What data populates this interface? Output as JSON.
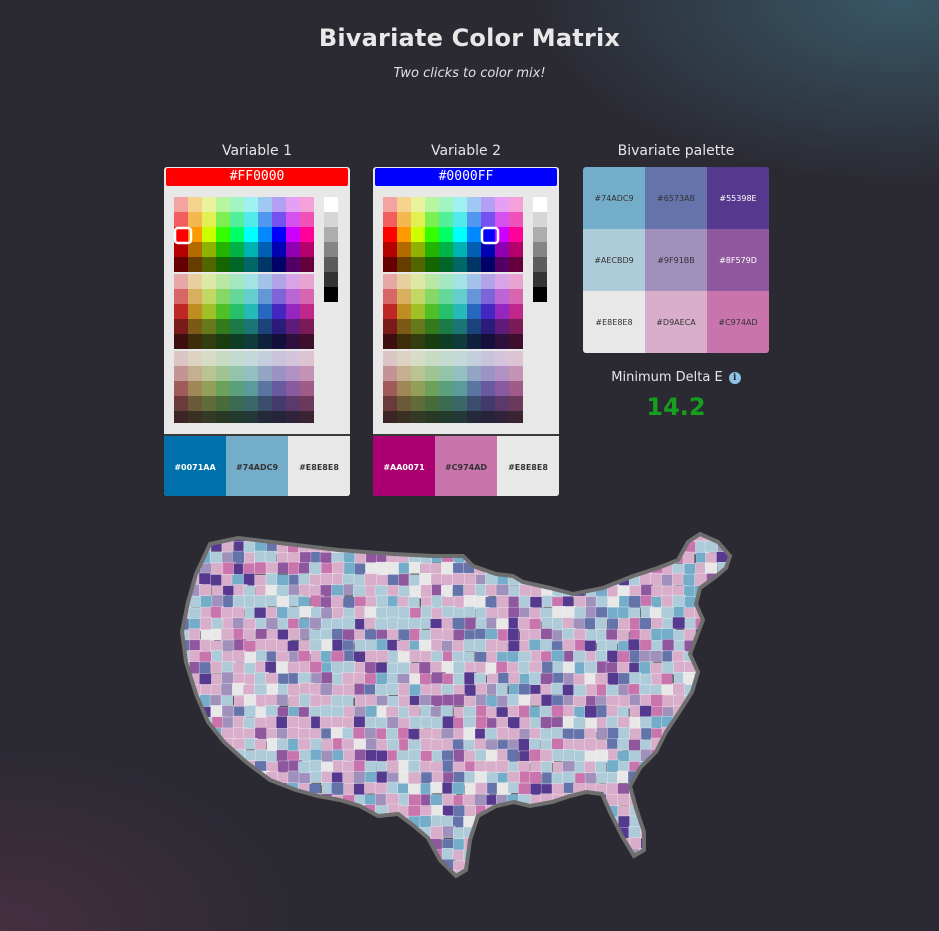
{
  "header": {
    "title": "Bivariate Color Matrix",
    "subtitle": "Two clicks to color mix!"
  },
  "variable1": {
    "label": "Variable 1",
    "hex": "#FF0000",
    "hex_color": "#FF0000",
    "swatches": [
      {
        "label": "#0071AA",
        "color": "#0071AA",
        "text_color": "#FFFFFF"
      },
      {
        "label": "#74ADC9",
        "color": "#74ADC9",
        "text_color": "#333333"
      },
      {
        "label": "#E8E8E8",
        "color": "#E8E8E8",
        "text_color": "#333333"
      }
    ]
  },
  "variable2": {
    "label": "Variable 2",
    "hex": "#0000FF",
    "hex_color": "#0000FF",
    "swatches": [
      {
        "label": "#AA0071",
        "color": "#AA0071",
        "text_color": "#FFFFFF"
      },
      {
        "label": "#C974AD",
        "color": "#C974AD",
        "text_color": "#333333"
      },
      {
        "label": "#E8E8E8",
        "color": "#E8E8E8",
        "text_color": "#333333"
      }
    ]
  },
  "palette": {
    "label": "Bivariate palette",
    "cells": [
      {
        "label": "#74ADC9",
        "color": "#74ADC9",
        "text_color": "#333333"
      },
      {
        "label": "#6573AB",
        "color": "#6573AB",
        "text_color": "#333333"
      },
      {
        "label": "#55398E",
        "color": "#55398E",
        "text_color": "#FFFFFF"
      },
      {
        "label": "#AECBD9",
        "color": "#AECBD9",
        "text_color": "#333333"
      },
      {
        "label": "#9F91BB",
        "color": "#9F91BB",
        "text_color": "#333333"
      },
      {
        "label": "#8F579D",
        "color": "#8F579D",
        "text_color": "#FFFFFF"
      },
      {
        "label": "#E8E8E8",
        "color": "#E8E8E8",
        "text_color": "#333333"
      },
      {
        "label": "#D9AECA",
        "color": "#D9AECA",
        "text_color": "#333333"
      },
      {
        "label": "#C974AD",
        "color": "#C974AD",
        "text_color": "#333333"
      }
    ]
  },
  "delta": {
    "label": "Minimum Delta E",
    "value": "14.2",
    "icon": "info-icon"
  },
  "picker_grid": {
    "rows": [
      [
        "#F4A3A3",
        "#F6D28F",
        "#EAF29B",
        "#B8F5A0",
        "#A0F5C3",
        "#A0F2F2",
        "#A0C8F5",
        "#B3A0F5",
        "#E5A0F5",
        "#F5A0D8"
      ],
      [
        "#F25E5E",
        "#F5B84E",
        "#E2F052",
        "#7CF052",
        "#52F09A",
        "#52EAEA",
        "#5298F0",
        "#7552F0",
        "#D652F0",
        "#F052B8"
      ],
      [
        "#FF0000",
        "#FF9900",
        "#CCFF00",
        "#33FF00",
        "#00FF66",
        "#00FFFF",
        "#0088FF",
        "#0000FF",
        "#CC00FF",
        "#FF0099"
      ],
      [
        "#B30000",
        "#B36B00",
        "#8FB300",
        "#24B300",
        "#00B347",
        "#00B3B3",
        "#005FB3",
        "#0000B3",
        "#8F00B3",
        "#B3006B"
      ],
      [
        "#660000",
        "#663D00",
        "#526600",
        "#146600",
        "#006629",
        "#006666",
        "#003666",
        "#000066",
        "#520066",
        "#66003D"
      ],
      [
        "#E8A7A7",
        "#E8CFA0",
        "#DCE8A3",
        "#B8E8A3",
        "#A3E8C0",
        "#A3E3E3",
        "#A3C3E8",
        "#B2A3E8",
        "#D9A3E8",
        "#E8A3D1"
      ],
      [
        "#D76767",
        "#D7AF5F",
        "#C3D765",
        "#86D765",
        "#65D79A",
        "#65CFCF",
        "#6596D7",
        "#7D65D7",
        "#BC65D7",
        "#D765AF"
      ],
      [
        "#C02727",
        "#C08E20",
        "#A0C027",
        "#4FC027",
        "#27C06A",
        "#27B8B8",
        "#2767C0",
        "#4327C0",
        "#9427C0",
        "#C0278A"
      ],
      [
        "#7A1B1B",
        "#7A5A16",
        "#667A1B",
        "#327A1B",
        "#1B7A45",
        "#1B7575",
        "#1B427A",
        "#2B1B7A",
        "#5E1B7A",
        "#7A1B58"
      ],
      [
        "#3D0F0F",
        "#3D2D0B",
        "#333D0F",
        "#193D0F",
        "#0F3D23",
        "#0F3B3B",
        "#0F213D",
        "#150F3D",
        "#2F0F3D",
        "#3D0F2C"
      ],
      [
        "#DCC5C5",
        "#DCD3C2",
        "#D7DCC4",
        "#C8DCC4",
        "#C4DCCF",
        "#C4D9D9",
        "#C4CEDC",
        "#C9C4DC",
        "#D4C4DC",
        "#DCC4D3"
      ],
      [
        "#C49494",
        "#C4B08E",
        "#B9C492",
        "#9FC492",
        "#92C4AA",
        "#92BFBF",
        "#92A6C4",
        "#9D92C4",
        "#B292C4",
        "#C492B3"
      ],
      [
        "#A05A5A",
        "#A08756",
        "#92A05A",
        "#6DA05A",
        "#5AA07C",
        "#5A9C9C",
        "#5A75A0",
        "#685AA0",
        "#895AA0",
        "#A05A88"
      ],
      [
        "#6B3A3A",
        "#6B5A38",
        "#626B3A",
        "#486B3A",
        "#3A6B52",
        "#3A6868",
        "#3A4D6B",
        "#433A6B",
        "#5B3A6B",
        "#6B3A5A"
      ],
      [
        "#3A2424",
        "#3A3123",
        "#353A24",
        "#283A24",
        "#243A2E",
        "#243838",
        "#242A3A",
        "#26243A",
        "#31243A",
        "#3A2431"
      ]
    ],
    "grays": [
      "#FFFFFF",
      "#D6D6D6",
      "#ADADAD",
      "#858585",
      "#5C5C5C",
      "#333333",
      "#000000"
    ]
  },
  "map": {
    "fill_palette": [
      "#74ADC9",
      "#6573AB",
      "#55398E",
      "#AECBD9",
      "#9F91BB",
      "#8F579D",
      "#E8E8E8",
      "#D9AECA",
      "#C974AD"
    ],
    "border_color": "#6E6E6E"
  }
}
